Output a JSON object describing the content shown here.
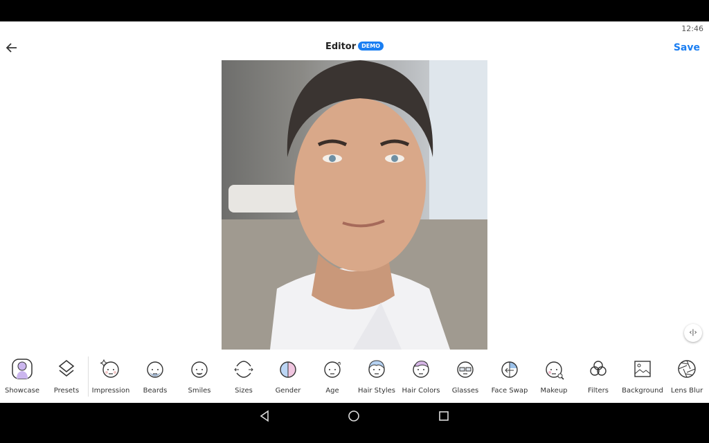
{
  "status": {
    "time": "12:46"
  },
  "header": {
    "title": "Editor",
    "badge": "DEMO",
    "save_label": "Save",
    "back_icon": "arrow-left-icon"
  },
  "colors": {
    "accent": "#1a7ef2"
  },
  "tools": [
    {
      "label": "Showcase",
      "icon": "portrait-icon"
    },
    {
      "label": "Presets",
      "icon": "layers-icon"
    },
    {
      "label": "Impression",
      "icon": "face-sparkle-icon"
    },
    {
      "label": "Beards",
      "icon": "face-beard-icon"
    },
    {
      "label": "Smiles",
      "icon": "face-smile-icon"
    },
    {
      "label": "Sizes",
      "icon": "face-resize-icon"
    },
    {
      "label": "Gender",
      "icon": "face-gender-icon"
    },
    {
      "label": "Age",
      "icon": "face-age-icon"
    },
    {
      "label": "Hair Styles",
      "icon": "face-hair-icon"
    },
    {
      "label": "Hair Colors",
      "icon": "face-haircolor-icon"
    },
    {
      "label": "Glasses",
      "icon": "face-glasses-icon"
    },
    {
      "label": "Face Swap",
      "icon": "face-swap-icon"
    },
    {
      "label": "Makeup",
      "icon": "face-makeup-icon"
    },
    {
      "label": "Filters",
      "icon": "filters-icon"
    },
    {
      "label": "Background",
      "icon": "image-icon"
    },
    {
      "label": "Lens Blur",
      "icon": "aperture-icon"
    }
  ]
}
